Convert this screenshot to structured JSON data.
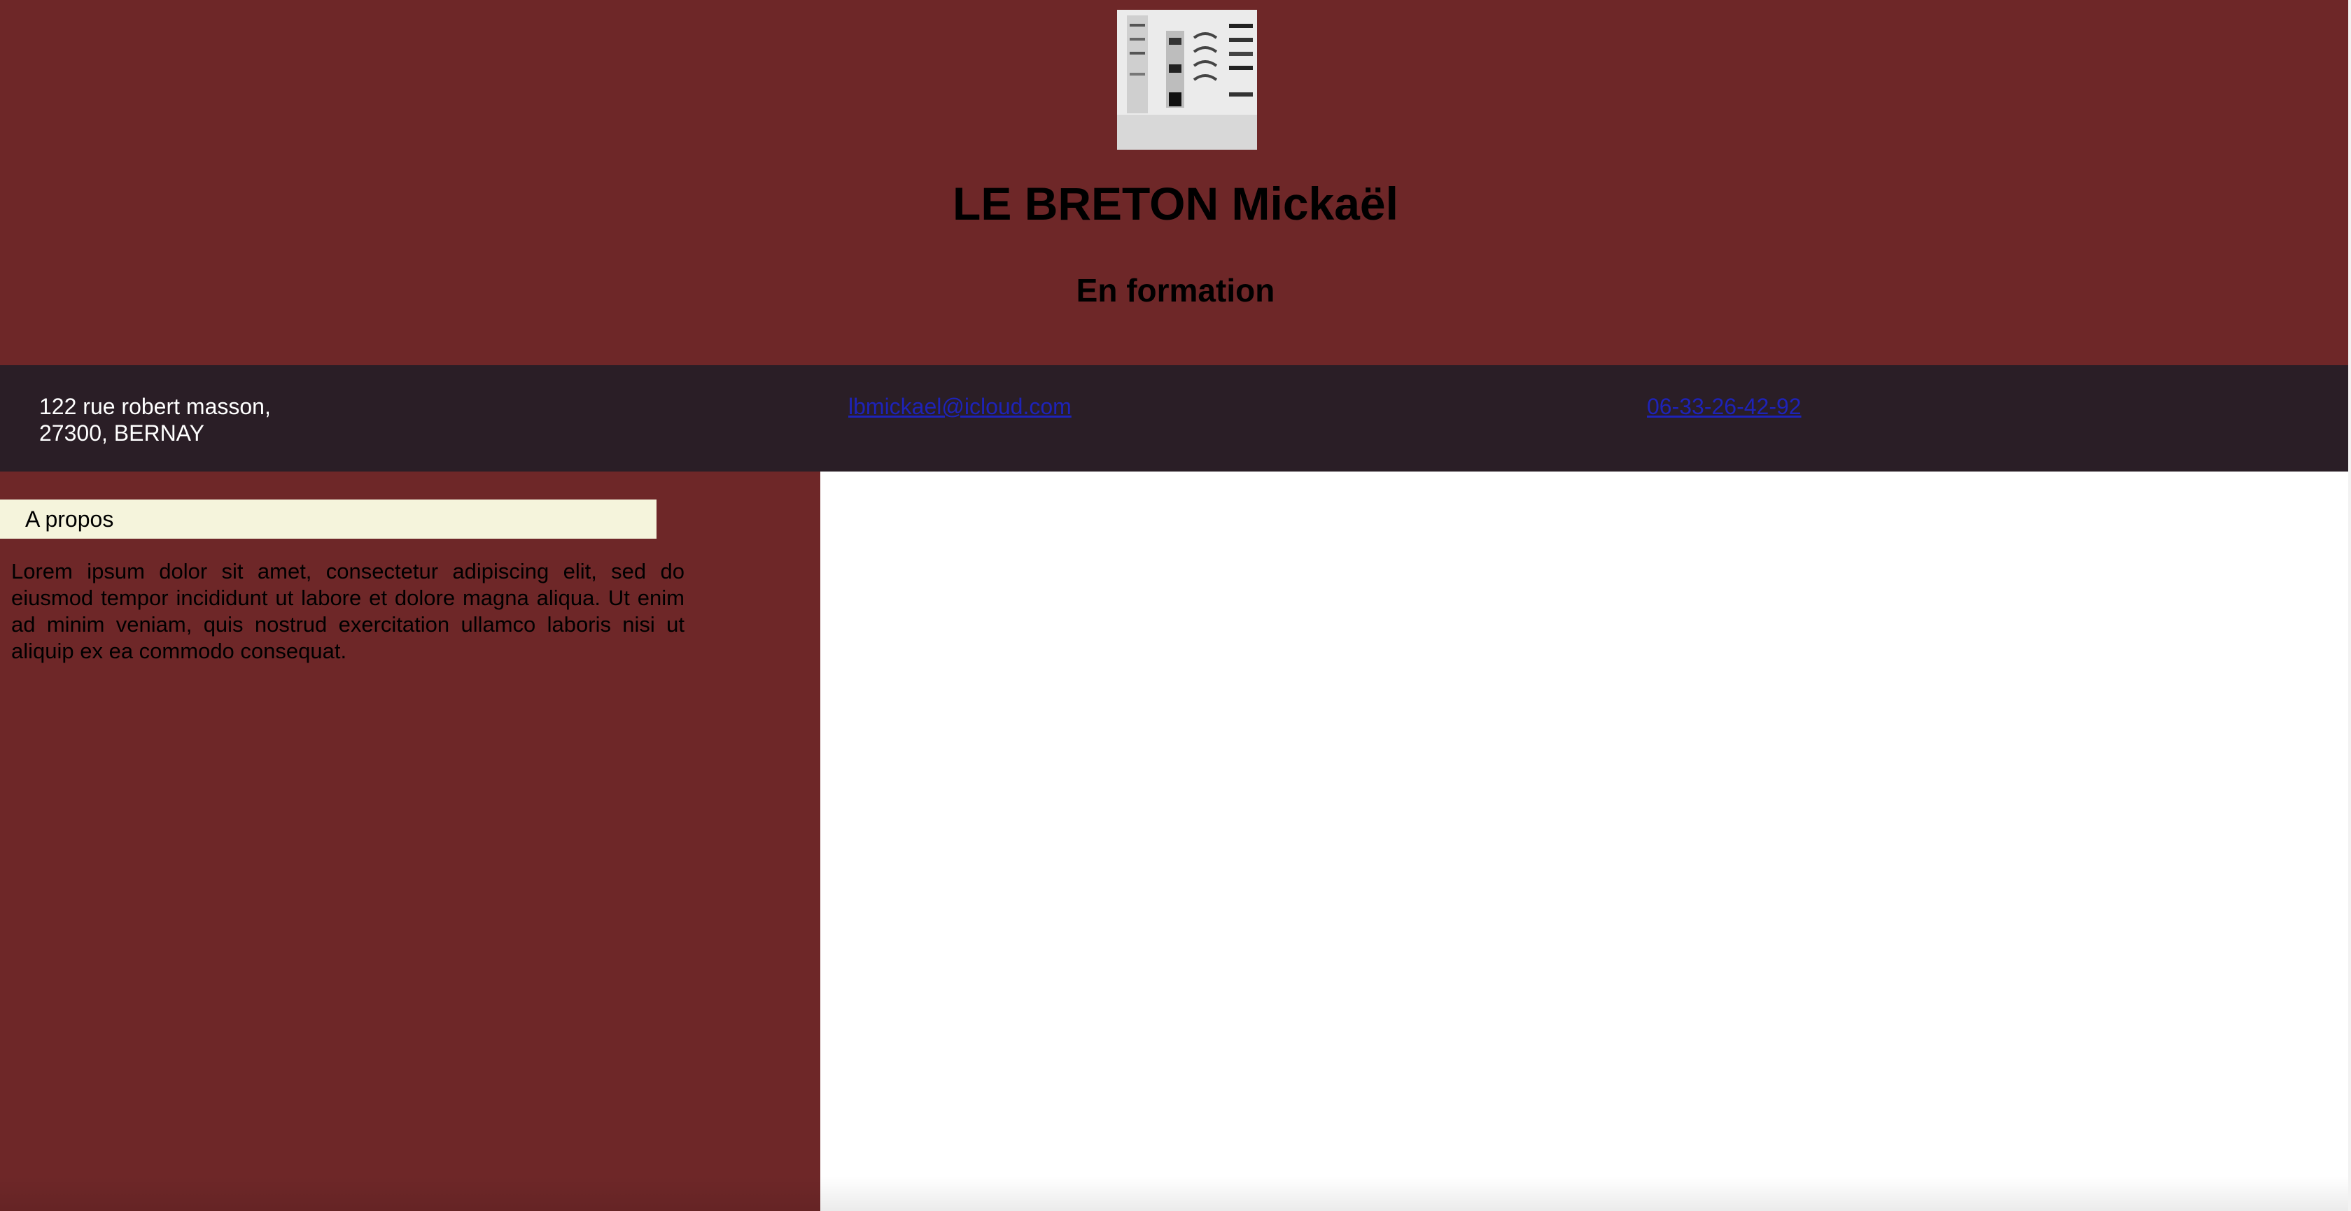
{
  "header": {
    "photo_icon": "profile-photo",
    "name": "LE BRETON Mickaël",
    "subtitle": "En formation"
  },
  "contact": {
    "address_line1": "122 rue robert masson,",
    "address_line2": "27300, BERNAY",
    "email": "lbmickael@icloud.com",
    "phone": "06-33-26-42-92"
  },
  "sidebar": {
    "about_heading": "A propos",
    "about_text": "Lorem ipsum dolor sit amet, consectetur adipiscing elit, sed do eiusmod tempor incididunt ut labore et dolore magna aliqua. Ut enim ad minim veniam, quis nostrud exercitation ullamco laboris nisi ut aliquip ex ea commodo consequat."
  },
  "colors": {
    "header_bg": "#6e2728",
    "contact_bar_bg": "#2a1e26",
    "heading_bg": "#f5f4dc",
    "link": "#1e23b8"
  }
}
